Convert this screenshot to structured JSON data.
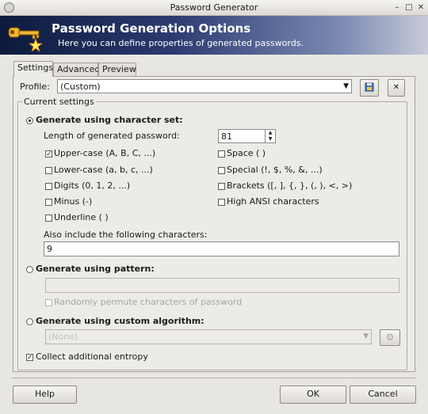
{
  "window": {
    "title": "Password Generator"
  },
  "banner": {
    "title": "Password Generation Options",
    "subtitle": "Here you can define properties of generated passwords."
  },
  "tabs": [
    {
      "label": "Settings"
    },
    {
      "label": "Advanced"
    },
    {
      "label": "Preview"
    }
  ],
  "profile": {
    "label": "Profile:",
    "value": "(Custom)"
  },
  "settings": {
    "group_label": "Current settings",
    "charset": {
      "label": "Generate using character set:",
      "length_label": "Length of generated password:",
      "length_value": "81",
      "options_left": [
        {
          "label": "Upper-case (A, B, C, ...)",
          "checked": true
        },
        {
          "label": "Lower-case (a, b, c, ...)",
          "checked": false
        },
        {
          "label": "Digits (0, 1, 2, ...)",
          "checked": false
        },
        {
          "label": "Minus (-)",
          "checked": false
        },
        {
          "label": "Underline ( )",
          "checked": false
        }
      ],
      "options_right": [
        {
          "label": "Space ( )",
          "checked": false
        },
        {
          "label": "Special (!, $, %, &, ...)",
          "checked": false
        },
        {
          "label": "Brackets ([, ], {, }, (, ), <, >)",
          "checked": false
        },
        {
          "label": "High ANSI characters",
          "checked": false
        }
      ],
      "also_include_label": "Also include the following characters:",
      "also_include_value": "9"
    },
    "pattern": {
      "label": "Generate using pattern:",
      "value": "",
      "permute_label": "Randomly permute characters of password"
    },
    "custom": {
      "label": "Generate using custom algorithm:",
      "value": "(None)"
    },
    "entropy": {
      "label": "Collect additional entropy",
      "checked": true
    }
  },
  "buttons": {
    "help": "Help",
    "ok": "OK",
    "cancel": "Cancel"
  },
  "selected_radio": "charset"
}
